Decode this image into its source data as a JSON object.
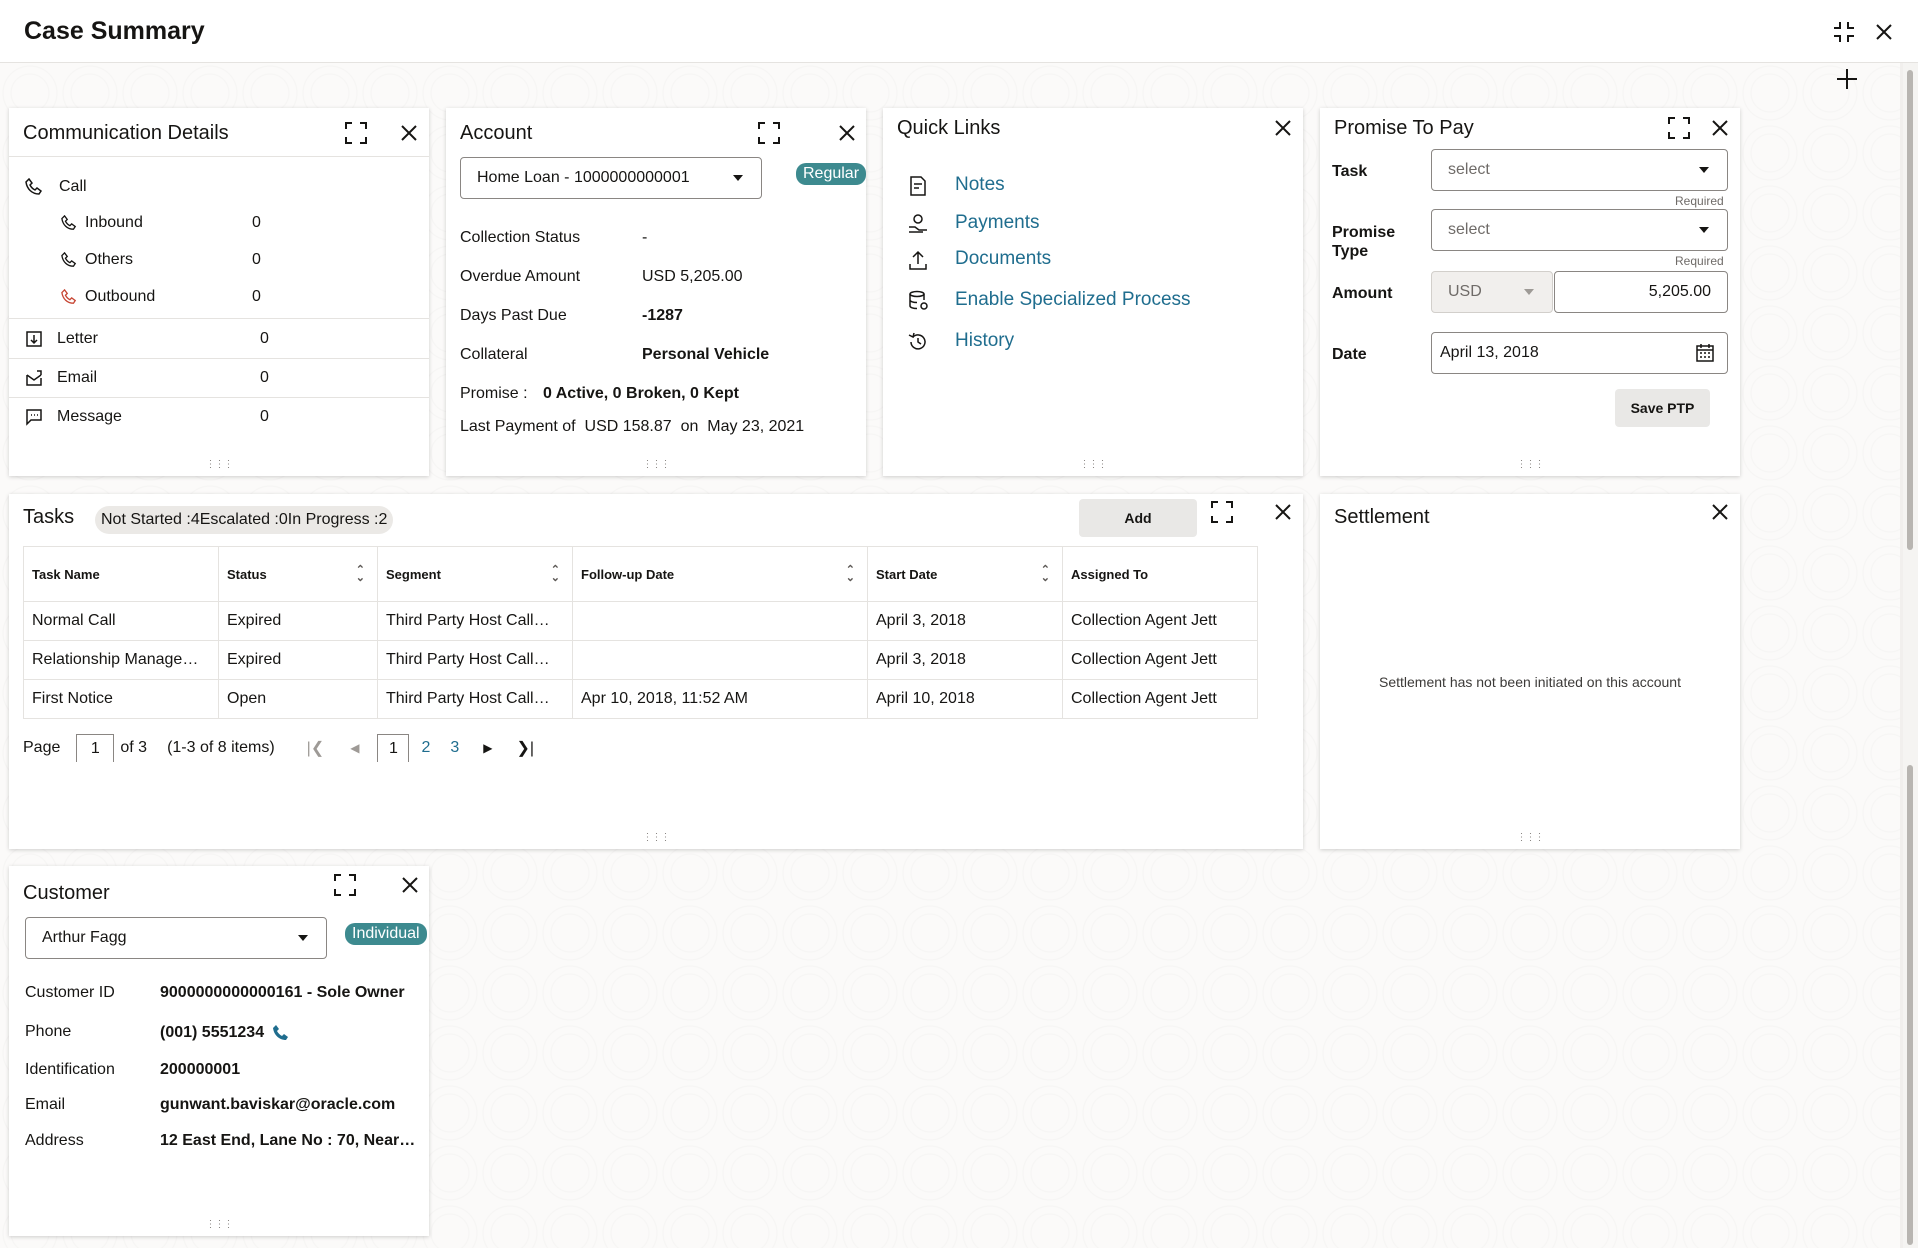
{
  "header": {
    "title": "Case Summary"
  },
  "communication": {
    "title": "Communication Details",
    "call_label": "Call",
    "calls": [
      {
        "label": "Inbound",
        "count": "0"
      },
      {
        "label": "Others",
        "count": "0"
      },
      {
        "label": "Outbound",
        "count": "0"
      }
    ],
    "channels": [
      {
        "label": "Letter",
        "count": "0"
      },
      {
        "label": "Email",
        "count": "0"
      },
      {
        "label": "Message",
        "count": "0"
      }
    ]
  },
  "account": {
    "title": "Account",
    "selected": "Home Loan - 1000000000001",
    "badge": "Regular",
    "fields": [
      {
        "label": "Collection Status",
        "value": "-"
      },
      {
        "label": "Overdue Amount",
        "value": "USD 5,205.00"
      },
      {
        "label": "Days Past Due",
        "value": "-1287"
      },
      {
        "label": "Collateral",
        "value": "Personal Vehicle"
      }
    ],
    "promise_label": "Promise :",
    "promise_value": "0 Active, 0 Broken, 0 Kept",
    "last_payment": "Last Payment of  USD 158.87  on  May 23, 2021"
  },
  "quick_links": {
    "title": "Quick Links",
    "items": [
      {
        "label": "Notes",
        "icon": "notes-icon"
      },
      {
        "label": "Payments",
        "icon": "payments-icon"
      },
      {
        "label": "Documents",
        "icon": "upload-icon"
      },
      {
        "label": "Enable Specialized Process",
        "icon": "database-icon"
      },
      {
        "label": "History",
        "icon": "history-icon"
      }
    ]
  },
  "ptp": {
    "title": "Promise To Pay",
    "task_label": "Task",
    "task_placeholder": "select",
    "type_label": "Promise\nType",
    "type_label_1": "Promise",
    "type_label_2": "Type",
    "type_placeholder": "select",
    "required": "Required",
    "amount_label": "Amount",
    "currency": "USD",
    "amount": "5,205.00",
    "date_label": "Date",
    "date": "April 13, 2018",
    "save": "Save PTP"
  },
  "tasks": {
    "title": "Tasks",
    "summary": "Not Started :4Escalated :0In Progress :2",
    "add": "Add",
    "columns": [
      "Task Name",
      "Status",
      "Segment",
      "Follow-up Date",
      "Start Date",
      "Assigned To"
    ],
    "rows": [
      [
        "Normal Call",
        "Expired",
        "Third Party Host Call…",
        "",
        "April 3, 2018",
        "Collection Agent Jett"
      ],
      [
        "Relationship Manage…",
        "Expired",
        "Third Party Host Call…",
        "",
        "April 3, 2018",
        "Collection Agent Jett"
      ],
      [
        "First Notice",
        "Open",
        "Third Party Host Call…",
        "Apr 10, 2018, 11:52 AM",
        "April 10, 2018",
        "Collection Agent Jett"
      ]
    ],
    "pager": {
      "page_label": "Page",
      "current": "1",
      "of": "of 3",
      "items": "(1-3 of 8 items)",
      "pages": [
        "1",
        "2",
        "3"
      ]
    }
  },
  "settlement": {
    "title": "Settlement",
    "message": "Settlement has not been initiated on this account"
  },
  "customer": {
    "title": "Customer",
    "selected": "Arthur Fagg",
    "badge": "Individual",
    "fields": [
      {
        "label": "Customer ID",
        "value": "9000000000000161 - Sole Owner"
      },
      {
        "label": "Phone",
        "value": "(001) 5551234"
      },
      {
        "label": "Identification",
        "value": "200000001"
      },
      {
        "label": "Email",
        "value": "gunwant.baviskar@oracle.com"
      },
      {
        "label": "Address",
        "value": "12 East End, Lane No : 70, Near…"
      }
    ]
  },
  "colors": {
    "accent": "#3d8a8f",
    "link": "#1f6d8e",
    "call_outbound": "#c74634"
  }
}
